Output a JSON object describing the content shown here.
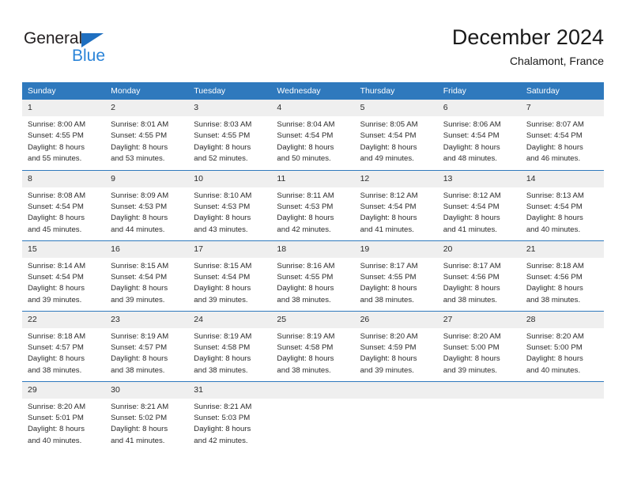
{
  "brand": {
    "name_part1": "General",
    "name_part2": "Blue",
    "triangle_color": "#1f6fc0",
    "blue_color": "#2b84d8"
  },
  "header": {
    "title": "December 2024",
    "subtitle": "Chalamont, France"
  },
  "theme": {
    "header_blue": "#2f79bd",
    "daynum_bg": "#efefef",
    "text": "#2b2b2b"
  },
  "weekdays": [
    "Sunday",
    "Monday",
    "Tuesday",
    "Wednesday",
    "Thursday",
    "Friday",
    "Saturday"
  ],
  "weeks": [
    [
      {
        "day": "1",
        "sunrise": "Sunrise: 8:00 AM",
        "sunset": "Sunset: 4:55 PM",
        "daylight1": "Daylight: 8 hours",
        "daylight2": "and 55 minutes."
      },
      {
        "day": "2",
        "sunrise": "Sunrise: 8:01 AM",
        "sunset": "Sunset: 4:55 PM",
        "daylight1": "Daylight: 8 hours",
        "daylight2": "and 53 minutes."
      },
      {
        "day": "3",
        "sunrise": "Sunrise: 8:03 AM",
        "sunset": "Sunset: 4:55 PM",
        "daylight1": "Daylight: 8 hours",
        "daylight2": "and 52 minutes."
      },
      {
        "day": "4",
        "sunrise": "Sunrise: 8:04 AM",
        "sunset": "Sunset: 4:54 PM",
        "daylight1": "Daylight: 8 hours",
        "daylight2": "and 50 minutes."
      },
      {
        "day": "5",
        "sunrise": "Sunrise: 8:05 AM",
        "sunset": "Sunset: 4:54 PM",
        "daylight1": "Daylight: 8 hours",
        "daylight2": "and 49 minutes."
      },
      {
        "day": "6",
        "sunrise": "Sunrise: 8:06 AM",
        "sunset": "Sunset: 4:54 PM",
        "daylight1": "Daylight: 8 hours",
        "daylight2": "and 48 minutes."
      },
      {
        "day": "7",
        "sunrise": "Sunrise: 8:07 AM",
        "sunset": "Sunset: 4:54 PM",
        "daylight1": "Daylight: 8 hours",
        "daylight2": "and 46 minutes."
      }
    ],
    [
      {
        "day": "8",
        "sunrise": "Sunrise: 8:08 AM",
        "sunset": "Sunset: 4:54 PM",
        "daylight1": "Daylight: 8 hours",
        "daylight2": "and 45 minutes."
      },
      {
        "day": "9",
        "sunrise": "Sunrise: 8:09 AM",
        "sunset": "Sunset: 4:53 PM",
        "daylight1": "Daylight: 8 hours",
        "daylight2": "and 44 minutes."
      },
      {
        "day": "10",
        "sunrise": "Sunrise: 8:10 AM",
        "sunset": "Sunset: 4:53 PM",
        "daylight1": "Daylight: 8 hours",
        "daylight2": "and 43 minutes."
      },
      {
        "day": "11",
        "sunrise": "Sunrise: 8:11 AM",
        "sunset": "Sunset: 4:53 PM",
        "daylight1": "Daylight: 8 hours",
        "daylight2": "and 42 minutes."
      },
      {
        "day": "12",
        "sunrise": "Sunrise: 8:12 AM",
        "sunset": "Sunset: 4:54 PM",
        "daylight1": "Daylight: 8 hours",
        "daylight2": "and 41 minutes."
      },
      {
        "day": "13",
        "sunrise": "Sunrise: 8:12 AM",
        "sunset": "Sunset: 4:54 PM",
        "daylight1": "Daylight: 8 hours",
        "daylight2": "and 41 minutes."
      },
      {
        "day": "14",
        "sunrise": "Sunrise: 8:13 AM",
        "sunset": "Sunset: 4:54 PM",
        "daylight1": "Daylight: 8 hours",
        "daylight2": "and 40 minutes."
      }
    ],
    [
      {
        "day": "15",
        "sunrise": "Sunrise: 8:14 AM",
        "sunset": "Sunset: 4:54 PM",
        "daylight1": "Daylight: 8 hours",
        "daylight2": "and 39 minutes."
      },
      {
        "day": "16",
        "sunrise": "Sunrise: 8:15 AM",
        "sunset": "Sunset: 4:54 PM",
        "daylight1": "Daylight: 8 hours",
        "daylight2": "and 39 minutes."
      },
      {
        "day": "17",
        "sunrise": "Sunrise: 8:15 AM",
        "sunset": "Sunset: 4:54 PM",
        "daylight1": "Daylight: 8 hours",
        "daylight2": "and 39 minutes."
      },
      {
        "day": "18",
        "sunrise": "Sunrise: 8:16 AM",
        "sunset": "Sunset: 4:55 PM",
        "daylight1": "Daylight: 8 hours",
        "daylight2": "and 38 minutes."
      },
      {
        "day": "19",
        "sunrise": "Sunrise: 8:17 AM",
        "sunset": "Sunset: 4:55 PM",
        "daylight1": "Daylight: 8 hours",
        "daylight2": "and 38 minutes."
      },
      {
        "day": "20",
        "sunrise": "Sunrise: 8:17 AM",
        "sunset": "Sunset: 4:56 PM",
        "daylight1": "Daylight: 8 hours",
        "daylight2": "and 38 minutes."
      },
      {
        "day": "21",
        "sunrise": "Sunrise: 8:18 AM",
        "sunset": "Sunset: 4:56 PM",
        "daylight1": "Daylight: 8 hours",
        "daylight2": "and 38 minutes."
      }
    ],
    [
      {
        "day": "22",
        "sunrise": "Sunrise: 8:18 AM",
        "sunset": "Sunset: 4:57 PM",
        "daylight1": "Daylight: 8 hours",
        "daylight2": "and 38 minutes."
      },
      {
        "day": "23",
        "sunrise": "Sunrise: 8:19 AM",
        "sunset": "Sunset: 4:57 PM",
        "daylight1": "Daylight: 8 hours",
        "daylight2": "and 38 minutes."
      },
      {
        "day": "24",
        "sunrise": "Sunrise: 8:19 AM",
        "sunset": "Sunset: 4:58 PM",
        "daylight1": "Daylight: 8 hours",
        "daylight2": "and 38 minutes."
      },
      {
        "day": "25",
        "sunrise": "Sunrise: 8:19 AM",
        "sunset": "Sunset: 4:58 PM",
        "daylight1": "Daylight: 8 hours",
        "daylight2": "and 38 minutes."
      },
      {
        "day": "26",
        "sunrise": "Sunrise: 8:20 AM",
        "sunset": "Sunset: 4:59 PM",
        "daylight1": "Daylight: 8 hours",
        "daylight2": "and 39 minutes."
      },
      {
        "day": "27",
        "sunrise": "Sunrise: 8:20 AM",
        "sunset": "Sunset: 5:00 PM",
        "daylight1": "Daylight: 8 hours",
        "daylight2": "and 39 minutes."
      },
      {
        "day": "28",
        "sunrise": "Sunrise: 8:20 AM",
        "sunset": "Sunset: 5:00 PM",
        "daylight1": "Daylight: 8 hours",
        "daylight2": "and 40 minutes."
      }
    ],
    [
      {
        "day": "29",
        "sunrise": "Sunrise: 8:20 AM",
        "sunset": "Sunset: 5:01 PM",
        "daylight1": "Daylight: 8 hours",
        "daylight2": "and 40 minutes."
      },
      {
        "day": "30",
        "sunrise": "Sunrise: 8:21 AM",
        "sunset": "Sunset: 5:02 PM",
        "daylight1": "Daylight: 8 hours",
        "daylight2": "and 41 minutes."
      },
      {
        "day": "31",
        "sunrise": "Sunrise: 8:21 AM",
        "sunset": "Sunset: 5:03 PM",
        "daylight1": "Daylight: 8 hours",
        "daylight2": "and 42 minutes."
      },
      {
        "day": "",
        "sunrise": "",
        "sunset": "",
        "daylight1": "",
        "daylight2": ""
      },
      {
        "day": "",
        "sunrise": "",
        "sunset": "",
        "daylight1": "",
        "daylight2": ""
      },
      {
        "day": "",
        "sunrise": "",
        "sunset": "",
        "daylight1": "",
        "daylight2": ""
      },
      {
        "day": "",
        "sunrise": "",
        "sunset": "",
        "daylight1": "",
        "daylight2": ""
      }
    ]
  ]
}
